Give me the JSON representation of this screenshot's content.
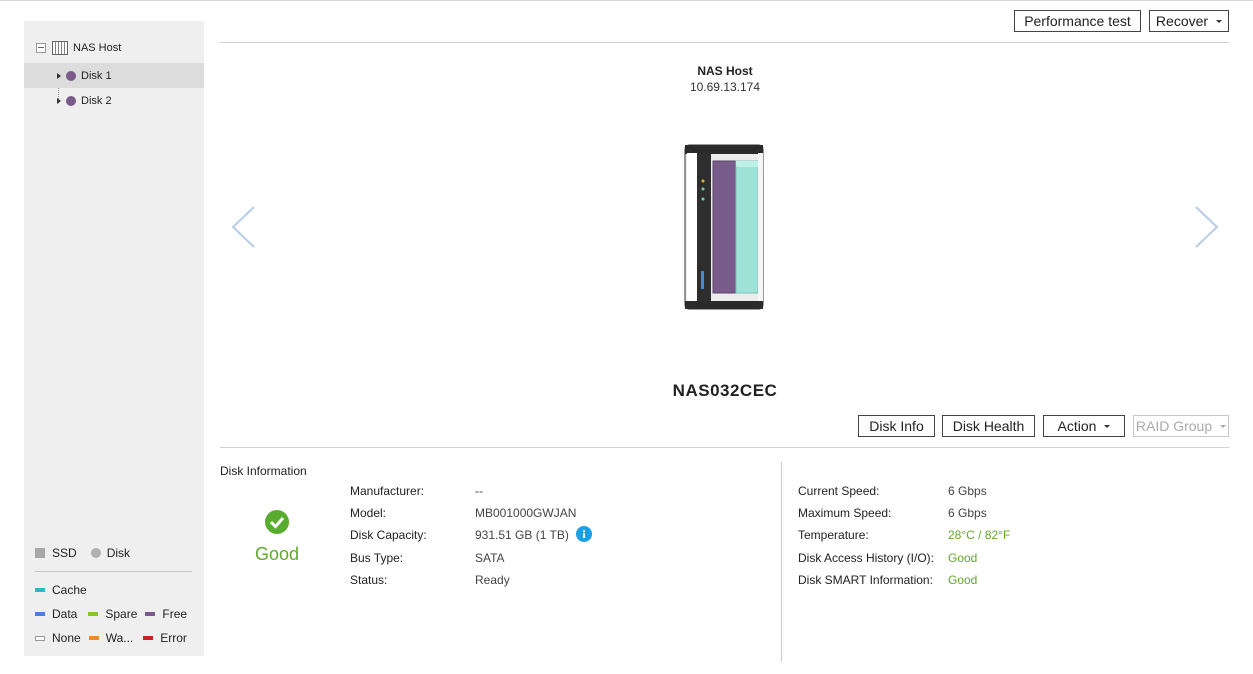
{
  "tree": {
    "host_label": "NAS Host",
    "disks": [
      {
        "label": "Disk 1"
      },
      {
        "label": "Disk 2"
      }
    ]
  },
  "legend": {
    "types": {
      "ssd": "SSD",
      "disk": "Disk"
    },
    "items": {
      "cache": "Cache",
      "data": "Data",
      "spare": "Spare",
      "free": "Free",
      "none": "None",
      "warning": "Wa...",
      "error": "Error"
    },
    "colors": {
      "cache": "#2bb9c8",
      "data": "#4d7fe0",
      "spare": "#86c81e",
      "free": "#7a5c8c",
      "none": "#ffffff",
      "warning": "#f08a24",
      "error": "#cc1f1f"
    }
  },
  "toolbar": {
    "performance_test": "Performance test",
    "recover": "Recover"
  },
  "device": {
    "name": "NAS Host",
    "ip": "10.69.13.174",
    "model": "NAS032CEC"
  },
  "disk_actions": {
    "disk_info": "Disk Info",
    "disk_health": "Disk Health",
    "action": "Action",
    "raid_group": "RAID Group"
  },
  "disk_info": {
    "section_title": "Disk Information",
    "health_status": "Good",
    "left": [
      {
        "label": "Manufacturer:",
        "value": "--"
      },
      {
        "label": "Model:",
        "value": "MB001000GWJAN"
      },
      {
        "label": "Disk Capacity:",
        "value": "931.51 GB (1 TB)"
      },
      {
        "label": "Bus Type:",
        "value": "SATA"
      },
      {
        "label": "Status:",
        "value": "Ready"
      }
    ],
    "right": [
      {
        "label": "Current Speed:",
        "value": "6 Gbps"
      },
      {
        "label": "Maximum Speed:",
        "value": "6 Gbps"
      },
      {
        "label": "Temperature:",
        "value": "28°C / 82°F"
      },
      {
        "label": "Disk Access History (I/O):",
        "value": "Good"
      },
      {
        "label": "Disk SMART Information:",
        "value": "Good"
      }
    ]
  }
}
